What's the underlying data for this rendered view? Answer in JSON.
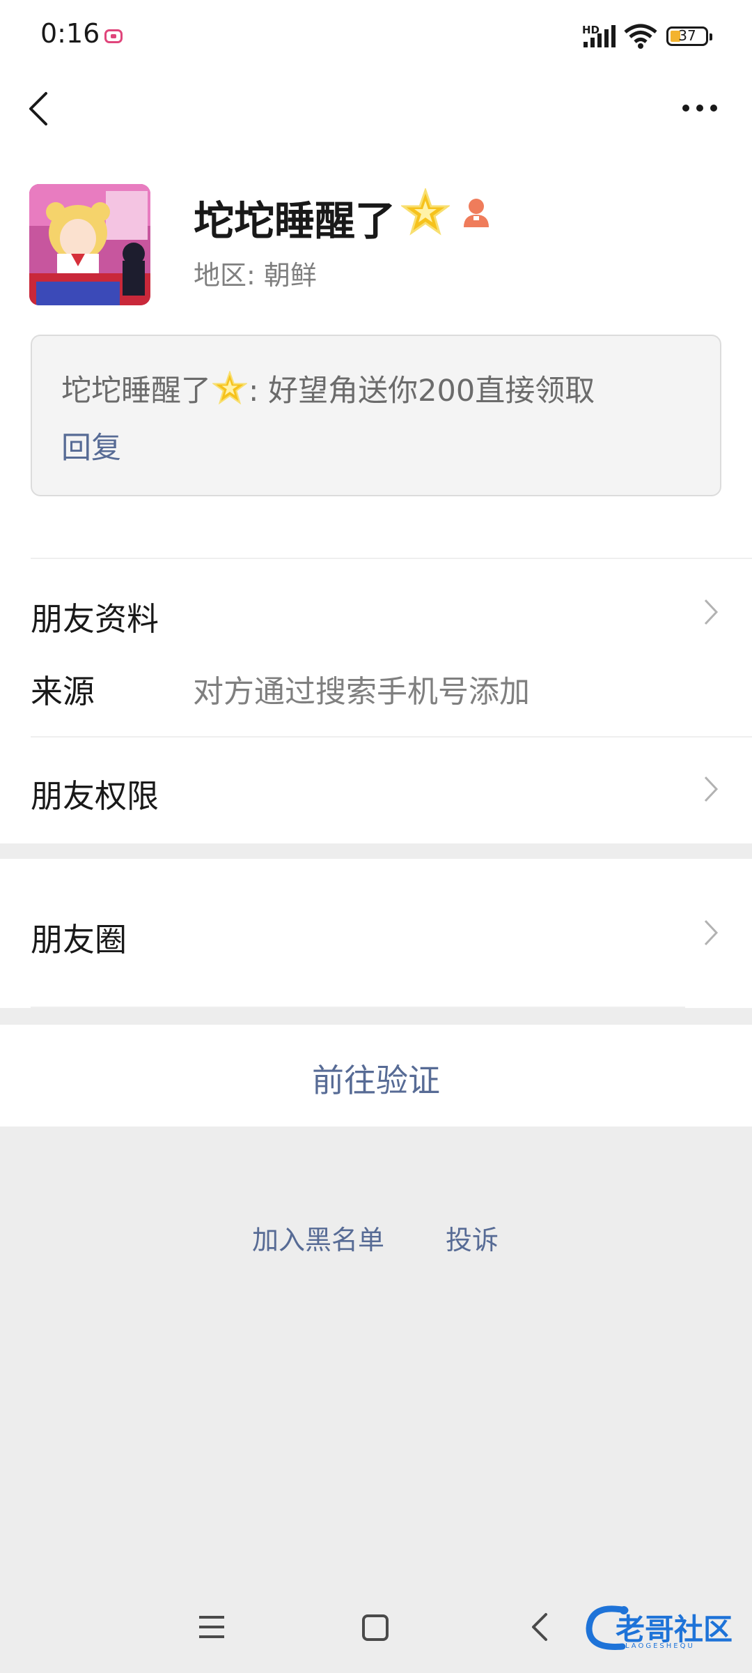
{
  "status_bar": {
    "time": "0:16",
    "hd": "HD",
    "battery": "37"
  },
  "profile": {
    "name": "坨坨睡醒了",
    "region": "地区: 朝鲜"
  },
  "message": {
    "sender_prefix": "坨坨睡醒了",
    "text": ": 好望角送你200直接领取",
    "reply_label": "回复"
  },
  "rows": {
    "friend_info": "朋友资料",
    "source_label": "来源",
    "source_value": "对方通过搜索手机号添加",
    "friend_permissions": "朋友权限",
    "moments": "朋友圈"
  },
  "actions": {
    "verify": "前往验证",
    "blacklist": "加入黑名单",
    "complain": "投诉"
  },
  "watermark": {
    "text": "老哥社区",
    "sub": "LAOGESHEQU"
  },
  "colors": {
    "link": "#576b95",
    "accent_star": "#f6c21c",
    "background": "#ededed"
  },
  "icons": [
    "back-arrow-icon",
    "more-icon",
    "star-icon",
    "person-icon",
    "chevron-right-icon",
    "menu-icon",
    "home-icon",
    "nav-back-icon"
  ]
}
